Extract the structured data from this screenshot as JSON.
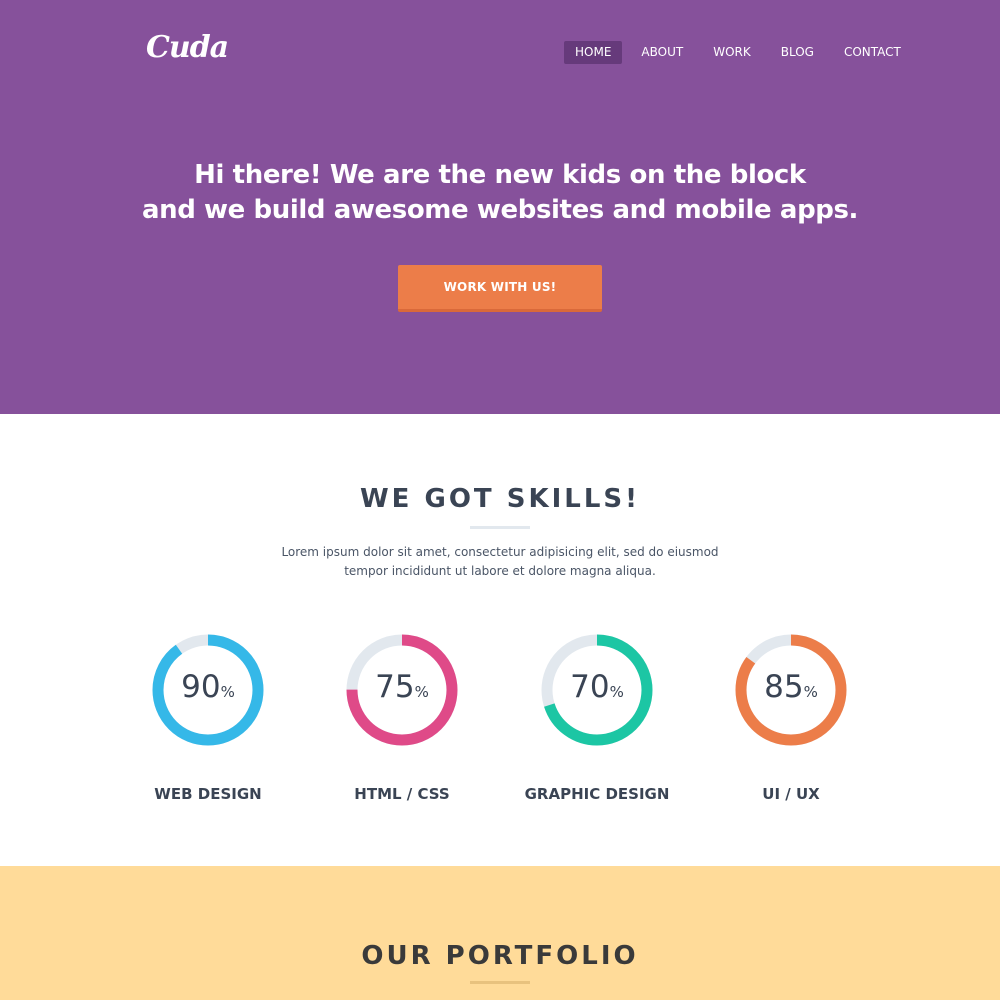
{
  "brand": {
    "logo_text": "Cuda"
  },
  "nav": {
    "items": [
      {
        "label": "HOME",
        "active": true
      },
      {
        "label": "ABOUT",
        "active": false
      },
      {
        "label": "WORK",
        "active": false
      },
      {
        "label": "BLOG",
        "active": false
      },
      {
        "label": "CONTACT",
        "active": false
      }
    ]
  },
  "hero": {
    "line1": "Hi there! We are the new kids on the block",
    "line2": "and we build awesome websites and mobile apps.",
    "cta_label": "WORK WITH US!"
  },
  "skills": {
    "title": "WE GOT SKILLS!",
    "lead_line1": "Lorem ipsum dolor sit amet, consectetur adipisicing elit, sed do eiusmod",
    "lead_line2": "tempor incididunt ut labore et dolore magna aliqua.",
    "items": [
      {
        "name": "WEB DESIGN",
        "value": "90",
        "fraction": 0.9,
        "color": "#35b8e8"
      },
      {
        "name": "HTML / CSS",
        "value": "75",
        "fraction": 0.75,
        "color": "#df4a88"
      },
      {
        "name": "GRAPHIC DESIGN",
        "value": "70",
        "fraction": 0.7,
        "color": "#1cc6a4"
      },
      {
        "name": "UI / UX",
        "value": "85",
        "fraction": 0.85,
        "color": "#ec7d49"
      }
    ],
    "percent_symbol": "%"
  },
  "portfolio": {
    "title": "OUR PORTFOLIO"
  },
  "colors": {
    "hero_bg": "#86519b",
    "cta": "#ec7d49",
    "portfolio_bg": "#ffdb99",
    "ring_track": "#e2e8ee"
  }
}
